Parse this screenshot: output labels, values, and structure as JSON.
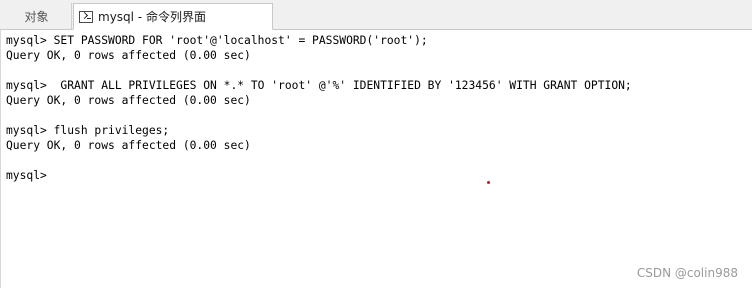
{
  "tabs": {
    "objects_label": "对象",
    "console_label": "mysql - 命令列界面",
    "console_icon": "console-icon"
  },
  "console": {
    "lines": [
      "mysql> SET PASSWORD FOR 'root'@'localhost' = PASSWORD('root');",
      "Query OK, 0 rows affected (0.00 sec)",
      "",
      "mysql>  GRANT ALL PRIVILEGES ON *.* TO 'root' @'%' IDENTIFIED BY '123456' WITH GRANT OPTION;",
      "Query OK, 0 rows affected (0.00 sec)",
      "",
      "mysql> flush privileges;",
      "Query OK, 0 rows affected (0.00 sec)",
      "",
      "mysql>"
    ]
  },
  "watermark": "CSDN @colin988",
  "colors": {
    "marker": "#e01010"
  }
}
